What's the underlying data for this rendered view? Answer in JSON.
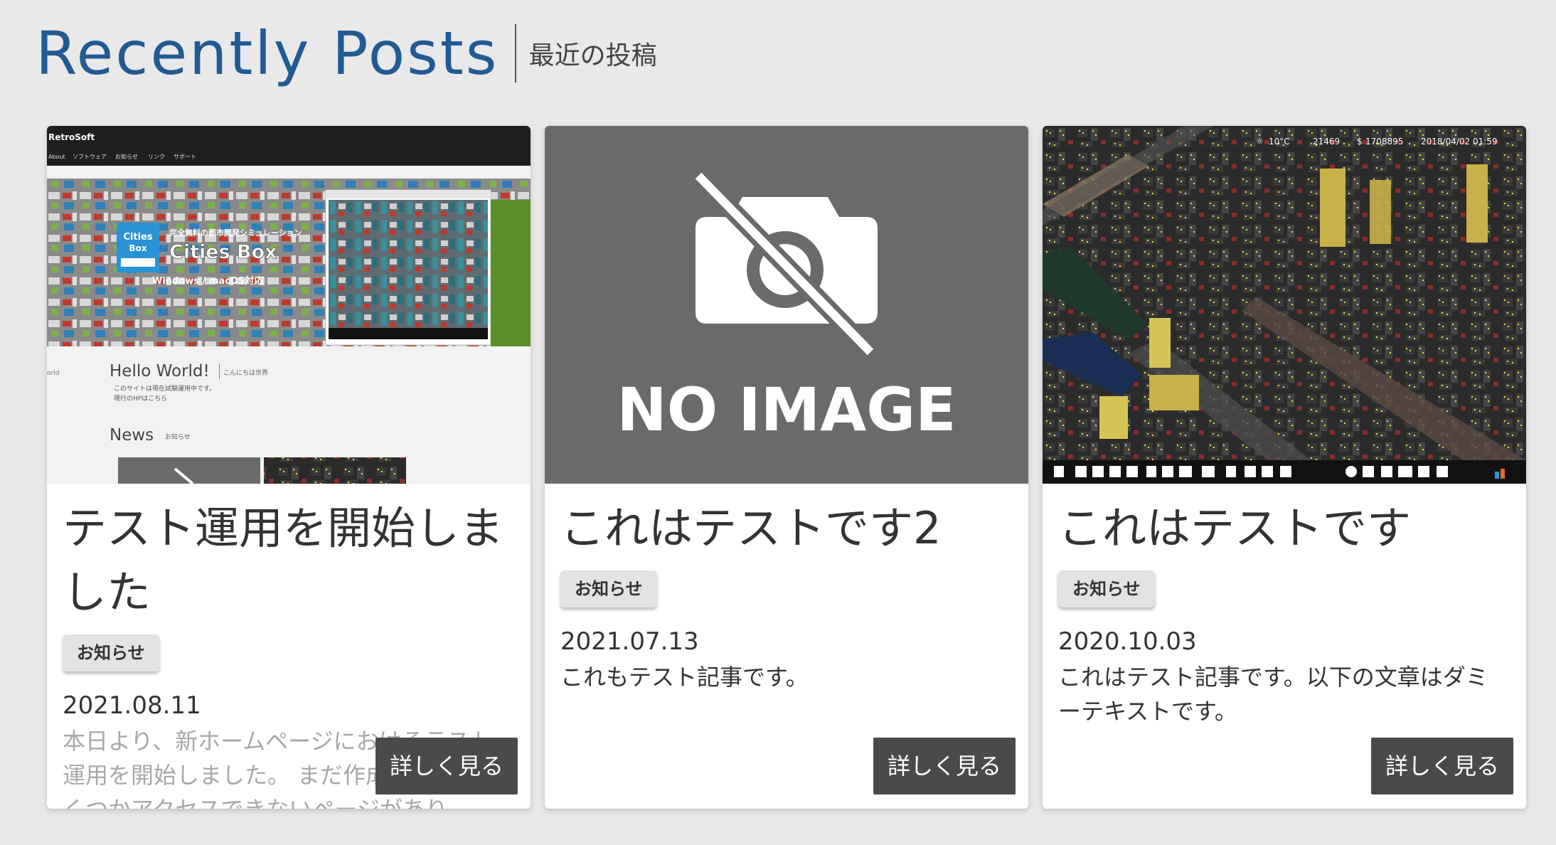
{
  "section": {
    "title": "Recently Posts",
    "subtitle": "最近の投稿"
  },
  "posts": [
    {
      "title": "テスト運用を開始しました",
      "category": "お知らせ",
      "date": "2021.08.11",
      "excerpt": "本日より、新ホームページにおけるテスト運用を開始しました。 まだ作成途中で、いくつかアクセスできないページがあり",
      "more_label": "詳しく見る",
      "thumbnail": {
        "site_name": "RetroSoft",
        "nav": [
          "About",
          "ソフトウェア",
          "お知らせ",
          "リンク",
          "サポート"
        ],
        "banner_tagline": "完全無料の都市開発シミュレーション",
        "banner_title": "Cities Box",
        "banner_platforms": "Windows / macOS対応",
        "logo_text": "Cities Box",
        "hello_title": "Hello World!",
        "hello_sub": "こんにちは世界",
        "hello_line1": "このサイトは現在試験運用中です。",
        "hello_line2": "現行のHPはこちら",
        "side_label": "orld",
        "news_title": "News",
        "news_sub": "お知らせ"
      }
    },
    {
      "title": "これはテストです2",
      "category": "お知らせ",
      "date": "2021.07.13",
      "excerpt": "これもテスト記事です。",
      "more_label": "詳しく見る",
      "thumbnail": {
        "placeholder_text": "NO IMAGE"
      }
    },
    {
      "title": "これはテストです",
      "category": "お知らせ",
      "date": "2020.10.03",
      "excerpt": "これはテスト記事です。以下の文章はダミーテキストです。",
      "more_label": "詳しく見る",
      "thumbnail": {
        "hud_temp": "10°C",
        "hud_population": "21469",
        "hud_money": "1708895",
        "hud_date": "2018/04/02 01:59"
      }
    }
  ],
  "colors": {
    "background": "#e9e9ea",
    "title_blue": "#225a94",
    "button_dark": "#4a4a4a",
    "noimage_gray": "#6a6a6a"
  }
}
